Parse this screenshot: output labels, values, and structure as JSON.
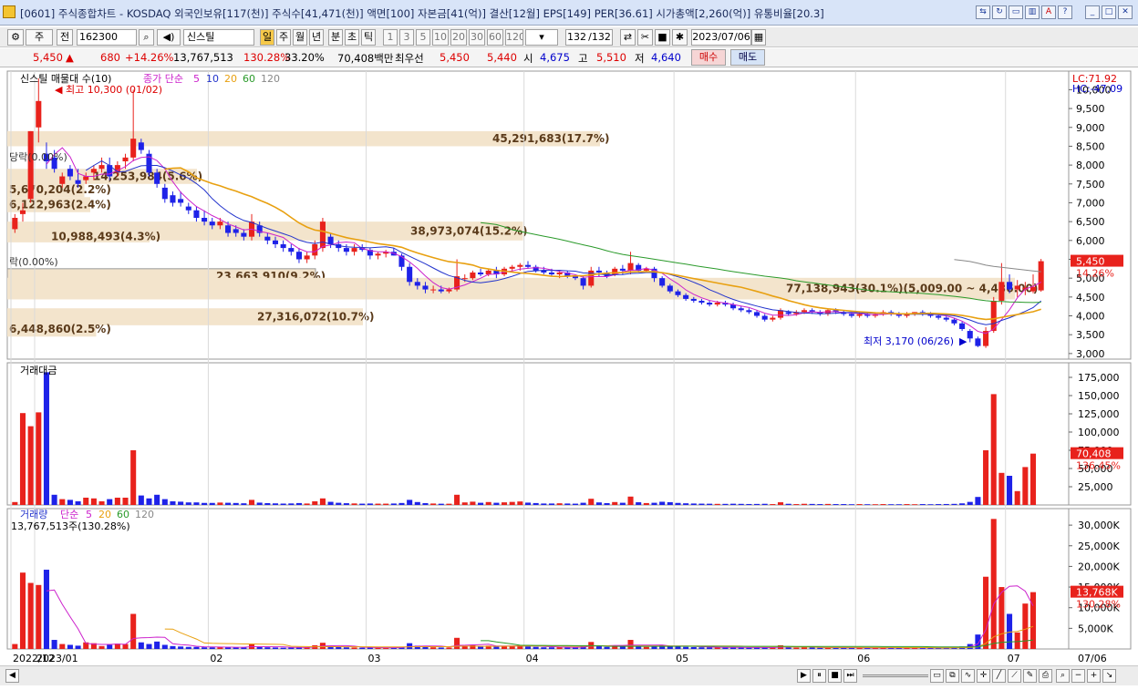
{
  "window": {
    "title": "[0601] 주식종합차트 - KOSDAQ 외국인보유[117(천)] 주식수[41,471(천)] 액면[100] 자본금[41(억)] 결산[12월] EPS[149] PER[36.61] 시가총액[2,260(억)] 유통비율[20.3]"
  },
  "toolbar": {
    "mode": "주",
    "period_type": "전",
    "code": "162300",
    "name": "신스틸",
    "tf": [
      "일",
      "주",
      "월",
      "년",
      "분",
      "초",
      "틱"
    ],
    "nums": [
      "1",
      "3",
      "5",
      "10",
      "20",
      "30",
      "60",
      "120"
    ],
    "count": "132",
    "count_total": "/132",
    "date": "2023/07/06"
  },
  "info": {
    "price": "5,450",
    "change": "680",
    "rate": "+14.26%",
    "volume": "13,767,513",
    "vol_rate": "130.28%",
    "turnover": "33.20%",
    "amount": "70,408백만",
    "best_label": "최우선",
    "ask": "5,450",
    "bid": "5,440",
    "open_label": "시",
    "open": "4,675",
    "high_label": "고",
    "high": "5,510",
    "low_label": "저",
    "low": "4,640",
    "buy": "매수",
    "sell": "매도"
  },
  "price_panel": {
    "legend_title": "신스틸 매물대 수(10)",
    "legend_ma": "종가 단순",
    "ma": [
      "5",
      "10",
      "20",
      "60",
      "120"
    ],
    "lc": "LC:71.92",
    "hc": "HC:-47.09",
    "high_note": "최고 10,300 (01/02)",
    "low_note": "최저 3,170 (06/26)",
    "current": "5,450",
    "current_rate": "14.26%",
    "y_ticks": [
      "10,000",
      "9,500",
      "9,000",
      "8,500",
      "8,000",
      "7,500",
      "7,000",
      "6,500",
      "6,000",
      "5,500",
      "5,000",
      "4,500",
      "4,000",
      "3,500",
      "3,000"
    ],
    "vp": [
      {
        "label": "45,291,683(17.7%)"
      },
      {
        "label": "38,973,074(15.2%)"
      },
      {
        "label": "27,316,072(10.7%)"
      },
      {
        "label": "23,663,910(9.2%)"
      },
      {
        "label": "77,138,943(30.1%)(5,009.00 ~ 4,436.00)"
      },
      {
        "label": "14,253,984(5.6%)"
      },
      {
        "label": "10,988,493(4.3%)"
      },
      {
        "label": "6,448,860(2.5%)"
      },
      {
        "label": "5,670,204(2.2%)"
      },
      {
        "label": "6,122,963(2.4%)"
      }
    ],
    "side_labels": [
      "당락(0.00%)",
      "락(0.00%)"
    ]
  },
  "amount_panel": {
    "title": "거래대금",
    "current": "70,408",
    "rate": "136.45%",
    "y_ticks": [
      "175,000",
      "150,000",
      "125,000",
      "100,000",
      "75,000",
      "50,000",
      "25,000"
    ]
  },
  "volume_panel": {
    "title": "거래량",
    "legend_ma": "단순",
    "ma": [
      "5",
      "20",
      "60",
      "120"
    ],
    "sub": "13,767,513주(130.28%)",
    "current": "13,768K",
    "rate": "130.28%",
    "y_ticks": [
      "30,000K",
      "25,000K",
      "20,000K",
      "15,000K",
      "10,000K",
      "5,000K"
    ]
  },
  "x_labels": [
    "2022/12",
    "2023/01",
    "02",
    "03",
    "04",
    "05",
    "06",
    "07",
    "07/06"
  ],
  "colors": {
    "up": "#e8221c",
    "down": "#1e22e8",
    "vp": "#f3e4cc",
    "ma5": "#cc22cc",
    "ma10": "#2233cc",
    "ma20": "#e8a010",
    "ma60": "#2a9a2a",
    "ma120": "#888888"
  },
  "chart_data": {
    "type": "candlestick",
    "dates_first": "2022/12/27",
    "dates_last": "2023/07/06",
    "candles": [
      [
        6300,
        6700,
        6200,
        6600
      ],
      [
        6700,
        7000,
        6500,
        6800
      ],
      [
        7100,
        8900,
        7000,
        8900
      ],
      [
        9000,
        10300,
        8600,
        9700
      ],
      [
        8300,
        8600,
        7900,
        8100
      ],
      [
        8200,
        8400,
        7800,
        7900
      ],
      [
        7500,
        7800,
        7400,
        7700
      ],
      [
        7900,
        8000,
        7600,
        7700
      ],
      [
        7600,
        7900,
        7400,
        7500
      ],
      [
        7600,
        7800,
        7500,
        7700
      ],
      [
        7800,
        8000,
        7600,
        7900
      ],
      [
        7900,
        8200,
        7800,
        8000
      ],
      [
        8000,
        8200,
        7600,
        7700
      ],
      [
        7800,
        8100,
        7700,
        8000
      ],
      [
        8100,
        8300,
        7900,
        8200
      ],
      [
        8200,
        10000,
        8100,
        8700
      ],
      [
        8600,
        8700,
        8300,
        8400
      ],
      [
        8300,
        8400,
        7700,
        7800
      ],
      [
        7800,
        7900,
        7400,
        7500
      ],
      [
        7400,
        7500,
        7000,
        7100
      ],
      [
        7200,
        7300,
        6900,
        7000
      ],
      [
        7100,
        7300,
        6900,
        7000
      ],
      [
        6900,
        7000,
        6700,
        6800
      ],
      [
        6800,
        6900,
        6500,
        6600
      ],
      [
        6600,
        6800,
        6400,
        6500
      ],
      [
        6500,
        6600,
        6300,
        6400
      ],
      [
        6400,
        6600,
        6300,
        6500
      ],
      [
        6400,
        6500,
        6100,
        6200
      ],
      [
        6300,
        6400,
        6100,
        6200
      ],
      [
        6200,
        6300,
        6000,
        6100
      ],
      [
        6100,
        6700,
        6000,
        6500
      ],
      [
        6400,
        6500,
        6100,
        6200
      ],
      [
        6100,
        6200,
        5900,
        6000
      ],
      [
        6000,
        6100,
        5800,
        5900
      ],
      [
        5900,
        6000,
        5700,
        5800
      ],
      [
        5800,
        5900,
        5600,
        5700
      ],
      [
        5700,
        5800,
        5400,
        5500
      ],
      [
        5500,
        5700,
        5400,
        5600
      ],
      [
        5600,
        6000,
        5500,
        5900
      ],
      [
        5800,
        6600,
        5700,
        6500
      ],
      [
        6100,
        6200,
        5800,
        5900
      ],
      [
        5900,
        6000,
        5700,
        5800
      ],
      [
        5800,
        5900,
        5600,
        5700
      ],
      [
        5700,
        5900,
        5600,
        5800
      ],
      [
        5800,
        5900,
        5700,
        5750
      ],
      [
        5750,
        5800,
        5500,
        5600
      ],
      [
        5600,
        5700,
        5500,
        5650
      ],
      [
        5650,
        5750,
        5550,
        5700
      ],
      [
        5700,
        5800,
        5600,
        5600
      ],
      [
        5600,
        5650,
        5200,
        5300
      ],
      [
        5300,
        5400,
        4800,
        4900
      ],
      [
        4900,
        5000,
        4700,
        4800
      ],
      [
        4800,
        4900,
        4600,
        4700
      ],
      [
        4700,
        4800,
        4600,
        4700
      ],
      [
        4700,
        4800,
        4600,
        4650
      ],
      [
        4650,
        4750,
        4600,
        4700
      ],
      [
        4700,
        5500,
        4650,
        5050
      ],
      [
        5000,
        5100,
        4900,
        5000
      ],
      [
        5000,
        5200,
        4950,
        5150
      ],
      [
        5150,
        5250,
        5050,
        5100
      ],
      [
        5100,
        5250,
        5050,
        5200
      ],
      [
        5200,
        5300,
        5000,
        5100
      ],
      [
        5100,
        5300,
        5050,
        5250
      ],
      [
        5250,
        5350,
        5150,
        5300
      ],
      [
        5300,
        5400,
        5200,
        5350
      ],
      [
        5350,
        5450,
        5250,
        5300
      ],
      [
        5300,
        5350,
        5150,
        5200
      ],
      [
        5200,
        5300,
        5100,
        5150
      ],
      [
        5150,
        5250,
        5050,
        5100
      ],
      [
        5100,
        5200,
        5000,
        5150
      ],
      [
        5150,
        5200,
        5000,
        5050
      ],
      [
        5050,
        5100,
        4950,
        5000
      ],
      [
        5000,
        5050,
        4700,
        4800
      ],
      [
        4800,
        5300,
        4750,
        5200
      ],
      [
        5200,
        5300,
        5050,
        5150
      ],
      [
        5150,
        5200,
        5000,
        5050
      ],
      [
        5100,
        5300,
        5050,
        5250
      ],
      [
        5250,
        5350,
        5100,
        5200
      ],
      [
        5200,
        5700,
        5100,
        5400
      ],
      [
        5350,
        5400,
        5150,
        5200
      ],
      [
        5200,
        5300,
        5150,
        5250
      ],
      [
        5250,
        5300,
        4900,
        5000
      ],
      [
        5000,
        5050,
        4750,
        4800
      ],
      [
        4800,
        4850,
        4600,
        4650
      ],
      [
        4650,
        4700,
        4500,
        4550
      ],
      [
        4550,
        4600,
        4400,
        4450
      ],
      [
        4450,
        4500,
        4350,
        4400
      ],
      [
        4400,
        4450,
        4300,
        4350
      ],
      [
        4350,
        4400,
        4250,
        4300
      ],
      [
        4300,
        4400,
        4250,
        4350
      ],
      [
        4350,
        4400,
        4250,
        4300
      ],
      [
        4300,
        4350,
        4150,
        4200
      ],
      [
        4200,
        4250,
        4100,
        4150
      ],
      [
        4150,
        4200,
        4050,
        4100
      ],
      [
        4100,
        4150,
        3950,
        4000
      ],
      [
        4000,
        4050,
        3850,
        3900
      ],
      [
        3900,
        4000,
        3850,
        3950
      ],
      [
        3950,
        4200,
        3900,
        4150
      ],
      [
        4100,
        4150,
        4000,
        4050
      ],
      [
        4050,
        4150,
        4000,
        4100
      ],
      [
        4100,
        4200,
        4050,
        4150
      ],
      [
        4150,
        4200,
        4050,
        4100
      ],
      [
        4100,
        4150,
        4000,
        4050
      ],
      [
        4050,
        4200,
        4000,
        4150
      ],
      [
        4150,
        4200,
        4050,
        4100
      ],
      [
        4100,
        4150,
        4000,
        4050
      ],
      [
        4050,
        4100,
        3950,
        4000
      ],
      [
        4000,
        4100,
        3950,
        4050
      ],
      [
        4050,
        4100,
        3950,
        4000
      ],
      [
        4000,
        4100,
        3950,
        4050
      ],
      [
        4050,
        4150,
        4000,
        4100
      ],
      [
        4100,
        4150,
        4000,
        4050
      ],
      [
        4050,
        4100,
        3950,
        4000
      ],
      [
        4000,
        4100,
        3950,
        4050
      ],
      [
        4050,
        4100,
        4000,
        4100
      ],
      [
        4100,
        4150,
        4000,
        4050
      ],
      [
        4050,
        4100,
        3950,
        4000
      ],
      [
        4000,
        4050,
        3900,
        3950
      ],
      [
        3950,
        4000,
        3850,
        3900
      ],
      [
        3900,
        3950,
        3750,
        3800
      ],
      [
        3800,
        3850,
        3600,
        3650
      ],
      [
        3600,
        3650,
        3300,
        3400
      ],
      [
        3400,
        3450,
        3170,
        3200
      ],
      [
        3200,
        3700,
        3150,
        3600
      ],
      [
        3600,
        4500,
        3550,
        4400
      ],
      [
        4400,
        5400,
        4300,
        4900
      ],
      [
        4900,
        5100,
        4600,
        4700
      ],
      [
        4700,
        4950,
        4500,
        4800
      ],
      [
        4700,
        4900,
        4550,
        4750
      ],
      [
        4650,
        5100,
        4600,
        4770
      ],
      [
        4675,
        5510,
        4640,
        5450
      ]
    ],
    "volume_k": [
      1200,
      18500,
      16000,
      15500,
      19200,
      2200,
      1200,
      1000,
      800,
      1600,
      1400,
      700,
      1000,
      1300,
      1200,
      8500,
      1600,
      1200,
      1800,
      1000,
      700,
      600,
      500,
      500,
      400,
      400,
      500,
      450,
      400,
      350,
      1100,
      500,
      400,
      350,
      300,
      350,
      450,
      350,
      900,
      1500,
      700,
      500,
      400,
      350,
      300,
      350,
      300,
      300,
      350,
      500,
      1400,
      800,
      500,
      400,
      350,
      350,
      2700,
      700,
      900,
      600,
      800,
      600,
      700,
      800,
      900,
      600,
      500,
      400,
      400,
      450,
      400,
      350,
      600,
      1700,
      700,
      500,
      800,
      600,
      2200,
      700,
      500,
      600,
      900,
      800,
      600,
      500,
      450,
      400,
      400,
      350,
      350,
      400,
      350,
      300,
      350,
      400,
      300,
      900,
      400,
      300,
      400,
      350,
      300,
      350,
      300,
      300,
      250,
      300,
      250,
      250,
      300,
      250,
      250,
      300,
      250,
      300,
      250,
      300,
      350,
      400,
      600,
      1200,
      3500,
      17500,
      31500,
      15000,
      8500,
      4000,
      11000,
      13768
    ],
    "amount_m": [
      4000,
      126000,
      108000,
      127000,
      182000,
      14000,
      8000,
      7000,
      5000,
      10000,
      9000,
      5000,
      8000,
      10000,
      10000,
      75000,
      13000,
      9000,
      14000,
      8000,
      5000,
      4500,
      3500,
      3500,
      2800,
      2800,
      3300,
      3000,
      2700,
      2300,
      7000,
      3200,
      2500,
      2200,
      1900,
      2100,
      2600,
      2000,
      5000,
      9000,
      4300,
      3000,
      2400,
      2100,
      1800,
      2000,
      1800,
      1800,
      2000,
      2700,
      7000,
      4000,
      2500,
      2000,
      1700,
      1700,
      14000,
      3500,
      4500,
      3000,
      4000,
      3000,
      3600,
      4200,
      4800,
      3200,
      2600,
      2000,
      2000,
      2300,
      2000,
      1800,
      3000,
      8500,
      3500,
      2500,
      4000,
      3000,
      11500,
      3700,
      2600,
      3000,
      4400,
      3800,
      2800,
      2300,
      2000,
      1800,
      1700,
      1500,
      1500,
      1700,
      1500,
      1300,
      1400,
      1600,
      1200,
      3700,
      1600,
      1200,
      1600,
      1400,
      1200,
      1400,
      1200,
      1200,
      1000,
      1200,
      1000,
      1000,
      1200,
      1000,
      1000,
      1200,
      1000,
      1200,
      1000,
      1200,
      1300,
      1500,
      2200,
      4200,
      11000,
      75000,
      152000,
      44000,
      40000,
      19000,
      52000,
      70408
    ]
  }
}
